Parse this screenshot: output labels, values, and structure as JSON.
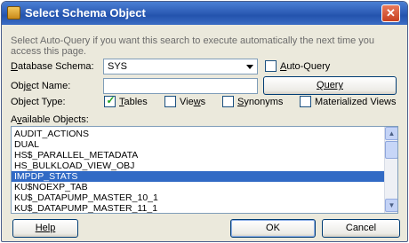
{
  "window": {
    "title": "Select Schema Object",
    "close_glyph": "✕"
  },
  "description": "Select Auto-Query if you want this search to execute automatically the next time you access this page.",
  "schema": {
    "label": "Database Schema:",
    "value": "SYS"
  },
  "auto_query": {
    "label": "Auto-Query",
    "checked": false
  },
  "object_name": {
    "label": "Object Name:",
    "value": ""
  },
  "query_button": "Query",
  "object_type": {
    "label": "Object Type:",
    "options": [
      {
        "label": "Tables",
        "checked": true
      },
      {
        "label": "Views",
        "checked": false
      },
      {
        "label": "Synonyms",
        "checked": false
      },
      {
        "label": "Materialized Views",
        "checked": false
      }
    ]
  },
  "available_objects": {
    "label": "Available Objects:",
    "items": [
      "AUDIT_ACTIONS",
      "DUAL",
      "HS$_PARALLEL_METADATA",
      "HS_BULKLOAD_VIEW_OBJ",
      "IMPDP_STATS",
      "KU$NOEXP_TAB",
      "KU$_DATAPUMP_MASTER_10_1",
      "KU$_DATAPUMP_MASTER_11_1"
    ],
    "selected_index": 4
  },
  "buttons": {
    "help": "Help",
    "ok": "OK",
    "cancel": "Cancel"
  },
  "scroll": {
    "up_glyph": "▲",
    "down_glyph": "▼"
  }
}
